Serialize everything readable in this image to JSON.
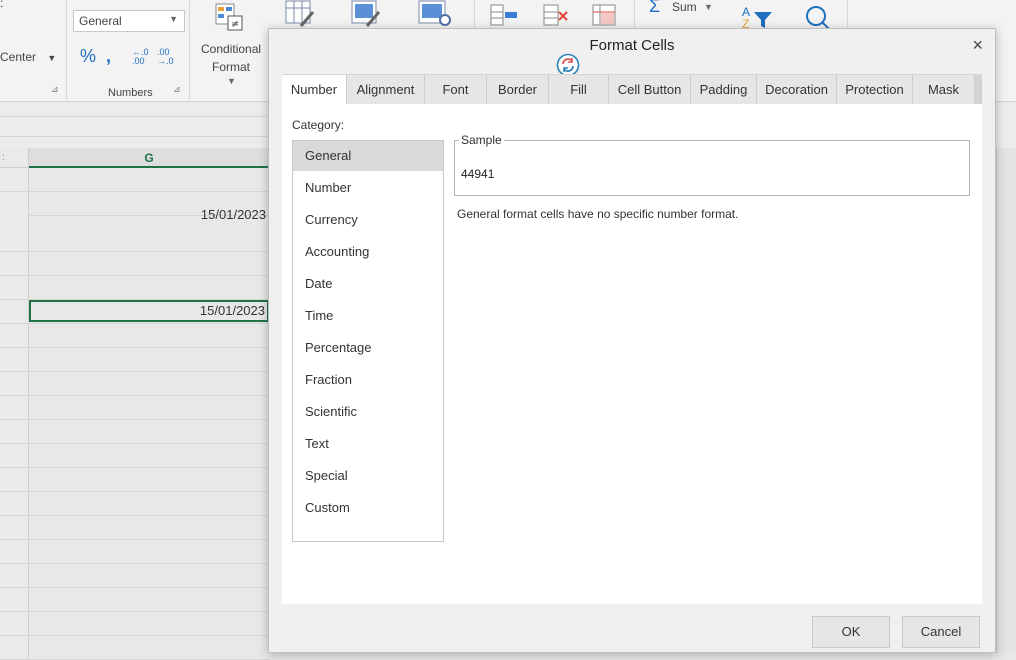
{
  "ribbon": {
    "align_center_label": "Center",
    "number_format_value": "General",
    "numbers_group_label": "Numbers",
    "conditional_format_line1": "Conditional",
    "conditional_format_line2": "Format",
    "sum_label": "Sum"
  },
  "sheet": {
    "column_header": "G",
    "cells": [
      {
        "value": "15/01/2023"
      },
      {
        "value": "15/01/2023"
      }
    ]
  },
  "dialog": {
    "title": "Format Cells",
    "close_glyph": "×",
    "tabs": [
      "Number",
      "Alignment",
      "Font",
      "Border",
      "Fill",
      "Cell Button",
      "Padding",
      "Decoration",
      "Protection",
      "Mask"
    ],
    "category_label": "Category:",
    "categories": [
      "General",
      "Number",
      "Currency",
      "Accounting",
      "Date",
      "Time",
      "Percentage",
      "Fraction",
      "Scientific",
      "Text",
      "Special",
      "Custom"
    ],
    "sample_label": "Sample",
    "sample_value": "44941",
    "description": "General format cells have no specific number format.",
    "ok_label": "OK",
    "cancel_label": "Cancel"
  }
}
